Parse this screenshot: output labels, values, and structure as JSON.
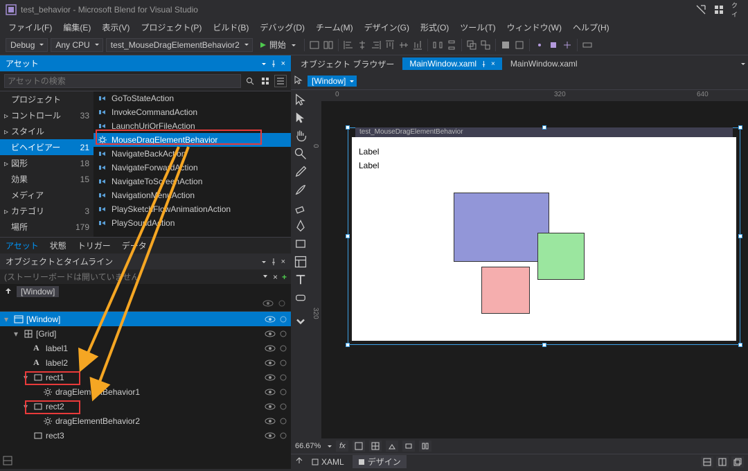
{
  "title": "test_behavior - Microsoft Blend for Visual Studio",
  "menu": [
    "ファイル(F)",
    "編集(E)",
    "表示(V)",
    "プロジェクト(P)",
    "ビルド(B)",
    "デバッグ(D)",
    "チーム(M)",
    "デザイン(G)",
    "形式(O)",
    "ツール(T)",
    "ウィンドウ(W)",
    "ヘルプ(H)"
  ],
  "toolbar": {
    "config": "Debug",
    "platform": "Any CPU",
    "target": "test_MouseDragElementBehavior2",
    "start": "開始"
  },
  "assets": {
    "header": "アセット",
    "search_ph": "アセットの検索",
    "tabs": [
      "アセット",
      "状態",
      "トリガー",
      "データ"
    ],
    "cats": [
      {
        "exp": "",
        "label": "プロジェクト",
        "count": ""
      },
      {
        "exp": "▹",
        "label": "コントロール",
        "count": "33"
      },
      {
        "exp": "▹",
        "label": "スタイル",
        "count": ""
      },
      {
        "exp": "",
        "label": "ビヘイビアー",
        "count": "21",
        "sel": true
      },
      {
        "exp": "▹",
        "label": "図形",
        "count": "18"
      },
      {
        "exp": "",
        "label": "効果",
        "count": "15"
      },
      {
        "exp": "",
        "label": "メディア",
        "count": ""
      },
      {
        "exp": "▹",
        "label": "カテゴリ",
        "count": "3"
      },
      {
        "exp": "",
        "label": "場所",
        "count": "179"
      }
    ],
    "items": [
      {
        "label": "GoToStateAction"
      },
      {
        "label": "InvokeCommandAction"
      },
      {
        "label": "LaunchUriOrFileAction"
      },
      {
        "label": "MouseDragElementBehavior",
        "sel": true,
        "gear": true
      },
      {
        "label": "NavigateBackAction"
      },
      {
        "label": "NavigateForwardAction"
      },
      {
        "label": "NavigateToScreenAction"
      },
      {
        "label": "NavigationMenuAction"
      },
      {
        "label": "PlaySketchFlowAnimationAction"
      },
      {
        "label": "PlaySoundAction"
      }
    ]
  },
  "objects": {
    "header": "オブジェクトとタイムライン",
    "storyboard_ph": "(ストーリーボードは開いていません",
    "root": "[Window]",
    "tree": [
      {
        "d": 0,
        "exp": "▾",
        "icn": "win",
        "label": "[Window]",
        "sel": true
      },
      {
        "d": 1,
        "exp": "▾",
        "icn": "grid",
        "label": "[Grid]"
      },
      {
        "d": 2,
        "exp": "",
        "icn": "A",
        "label": "label1"
      },
      {
        "d": 2,
        "exp": "",
        "icn": "A",
        "label": "label2"
      },
      {
        "d": 2,
        "exp": "▾",
        "icn": "rect",
        "label": "rect1",
        "hl": true
      },
      {
        "d": 3,
        "exp": "",
        "icn": "gear",
        "label": "dragElementBehavior1"
      },
      {
        "d": 2,
        "exp": "▾",
        "icn": "rect",
        "label": "rect2",
        "hl": true
      },
      {
        "d": 3,
        "exp": "",
        "icn": "gear",
        "label": "dragElementBehavior2"
      },
      {
        "d": 2,
        "exp": "",
        "icn": "rect",
        "label": "rect3"
      }
    ]
  },
  "designer": {
    "obj_browser": "オブジェクト ブラウザー",
    "tabs": [
      {
        "label": "MainWindow.xaml",
        "active": true,
        "pin": true,
        "close": true
      },
      {
        "label": "MainWindow.xaml"
      }
    ],
    "window_dd": "[Window]",
    "ruler_h": [
      {
        "p": 36,
        "t": "0"
      },
      {
        "p": 352,
        "t": "320"
      },
      {
        "p": 558,
        "t": "640"
      }
    ],
    "ruler_v": [
      {
        "p": 62,
        "t": "0"
      },
      {
        "p": 298,
        "t": "320"
      }
    ],
    "artboard_title": "test_MouseDragElementBehavior",
    "labels": [
      "Label",
      "Label"
    ],
    "zoom": "66.67%",
    "view_tabs": {
      "xaml": "XAML",
      "design": "デザイン"
    }
  }
}
